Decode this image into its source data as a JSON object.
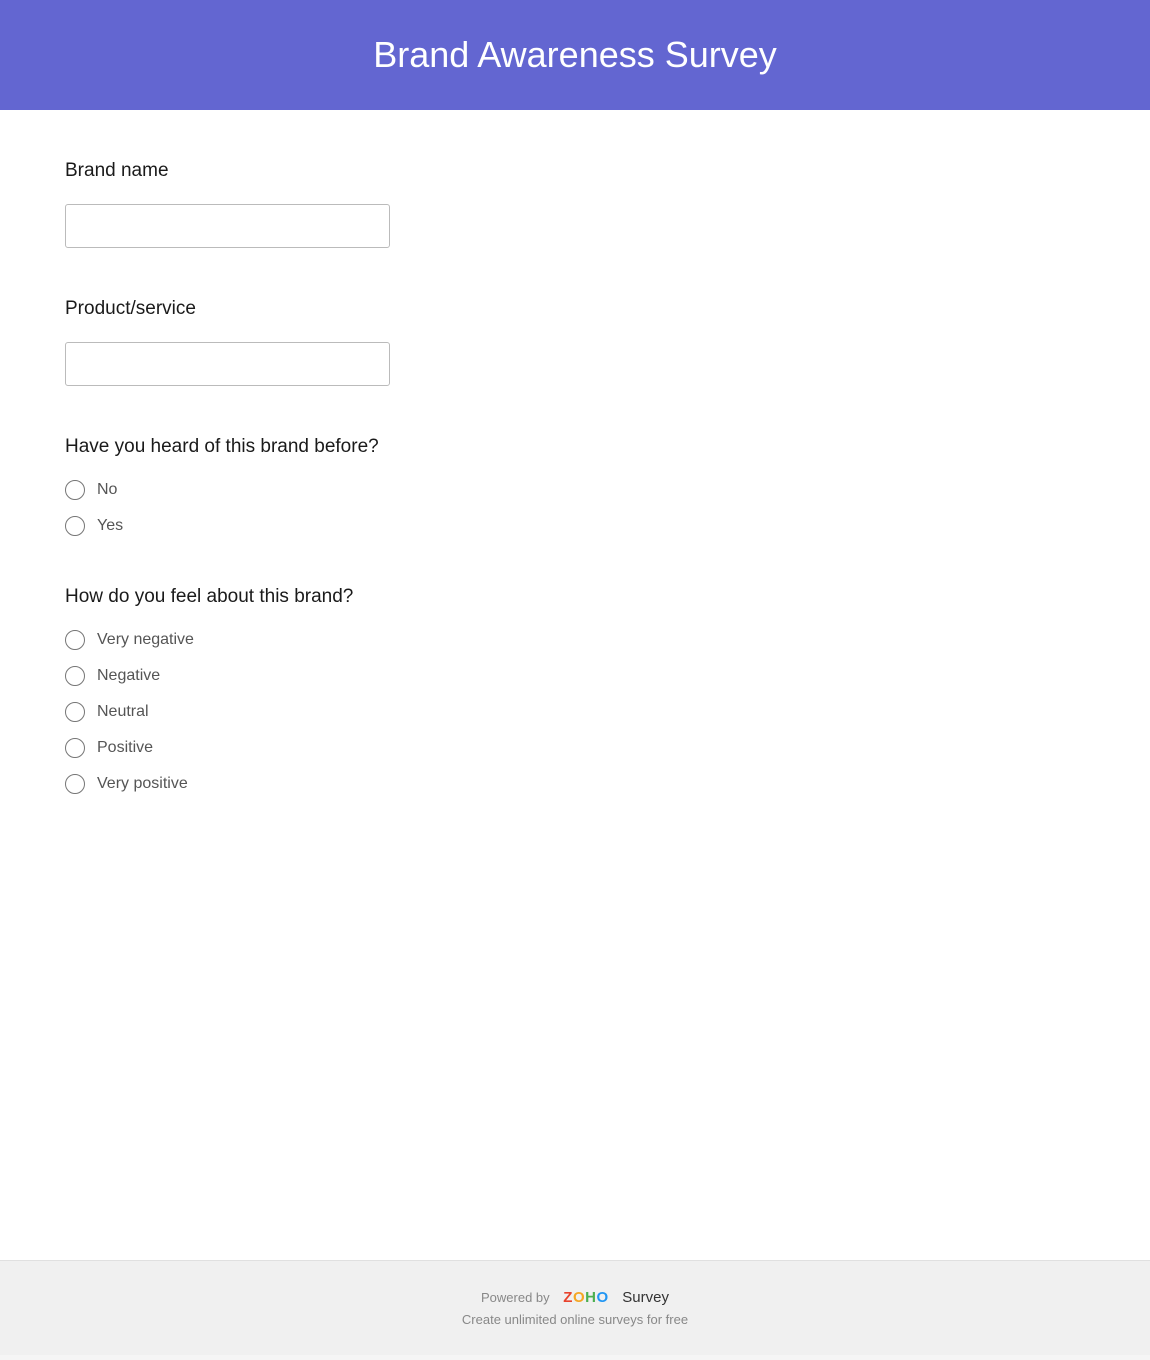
{
  "header": {
    "title": "Brand Awareness Survey",
    "bg_color": "#6366d1"
  },
  "questions": [
    {
      "id": "brand-name",
      "label": "Brand name",
      "type": "text",
      "placeholder": ""
    },
    {
      "id": "product-service",
      "label": "Product/service",
      "type": "text",
      "placeholder": ""
    },
    {
      "id": "heard-before",
      "label": "Have you heard of this brand before?",
      "type": "radio",
      "options": [
        "No",
        "Yes"
      ]
    },
    {
      "id": "brand-feeling",
      "label": "How do you feel about this brand?",
      "type": "radio",
      "options": [
        "Very negative",
        "Negative",
        "Neutral",
        "Positive",
        "Very positive"
      ]
    }
  ],
  "footer": {
    "powered_by_text": "Powered by",
    "zoho_letters": [
      "Z",
      "O",
      "H",
      "O"
    ],
    "survey_label": "Survey",
    "tagline": "Create unlimited online surveys for free"
  }
}
